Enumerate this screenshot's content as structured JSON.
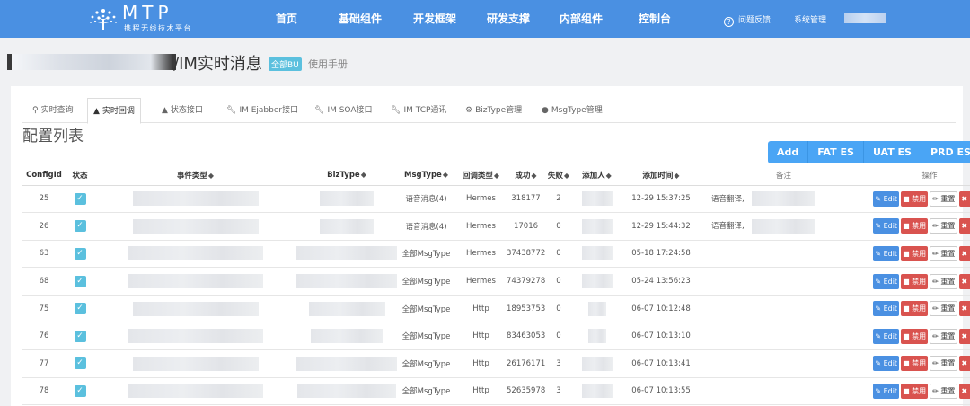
{
  "brand": {
    "name": "MTP",
    "subtitle": "携程无线技术平台"
  },
  "nav": [
    {
      "label": "首页"
    },
    {
      "label": "基础组件"
    },
    {
      "label": "开发框架"
    },
    {
      "label": "研发支撑"
    },
    {
      "label": "内部组件"
    },
    {
      "label": "控制台"
    }
  ],
  "nav_right": {
    "feedback": "问题反馈",
    "admin": "系统管理"
  },
  "page": {
    "title": "/IM实时消息",
    "badge": "全部BU",
    "manual": "使用手册"
  },
  "tabs": [
    {
      "label": "实时查询",
      "icon": "search-icon"
    },
    {
      "label": "实时回调",
      "icon": "bell-icon"
    },
    {
      "label": "状态接口",
      "icon": "bell-icon"
    },
    {
      "label": "IM Ejabber接口",
      "icon": "wrench-icon"
    },
    {
      "label": "IM SOA接口",
      "icon": "wrench-icon"
    },
    {
      "label": "IM TCP通讯",
      "icon": "wrench-icon"
    },
    {
      "label": "BizType管理",
      "icon": "gear-icon"
    },
    {
      "label": "MsgType管理",
      "icon": "comment-icon"
    }
  ],
  "section_title": "配置列表",
  "actions": [
    "Add",
    "FAT ES",
    "UAT ES",
    "PRD ES"
  ],
  "table": {
    "headers": {
      "configid": "ConfigId",
      "status": "状态",
      "event_type": "事件类型",
      "biztype": "BizType",
      "msgtype": "MsgType",
      "callback_type": "回调类型",
      "success": "成功",
      "fail": "失败",
      "adder": "添加人",
      "add_time": "添加时间",
      "note": "备注",
      "ops": "操作"
    },
    "op_labels": {
      "edit": "Edit",
      "disable": "禁用",
      "reset": "重置",
      "delete": "删除"
    },
    "rows": [
      {
        "id": "25",
        "msgtype": "语音消息(4)",
        "callback": "Hermes",
        "success": "318177",
        "fail": "2",
        "time": "12-29 15:37:25",
        "note": "语音翻译,"
      },
      {
        "id": "26",
        "msgtype": "语音消息(4)",
        "callback": "Hermes",
        "success": "17016",
        "fail": "0",
        "time": "12-29 15:44:32",
        "note": "语音翻译,"
      },
      {
        "id": "63",
        "msgtype": "全部MsgType",
        "callback": "Hermes",
        "success": "37438772",
        "fail": "0",
        "time": "05-18 17:24:58",
        "note": ""
      },
      {
        "id": "68",
        "msgtype": "全部MsgType",
        "callback": "Hermes",
        "success": "74379278",
        "fail": "0",
        "time": "05-24 13:56:23",
        "note": ""
      },
      {
        "id": "75",
        "msgtype": "全部MsgType",
        "callback": "Http",
        "success": "18953753",
        "fail": "0",
        "time": "06-07 10:12:48",
        "note": ""
      },
      {
        "id": "76",
        "msgtype": "全部MsgType",
        "callback": "Http",
        "success": "83463053",
        "fail": "0",
        "time": "06-07 10:13:10",
        "note": ""
      },
      {
        "id": "77",
        "msgtype": "全部MsgType",
        "callback": "Http",
        "success": "26176171",
        "fail": "3",
        "time": "06-07 10:13:41",
        "note": ""
      },
      {
        "id": "78",
        "msgtype": "全部MsgType",
        "callback": "Http",
        "success": "52635978",
        "fail": "3",
        "time": "06-07 10:13:55",
        "note": ""
      }
    ]
  },
  "colors": {
    "topbar": "#4a90e2",
    "badge": "#5bc0de",
    "primary": "#4aa5f5",
    "danger": "#d9534f"
  }
}
